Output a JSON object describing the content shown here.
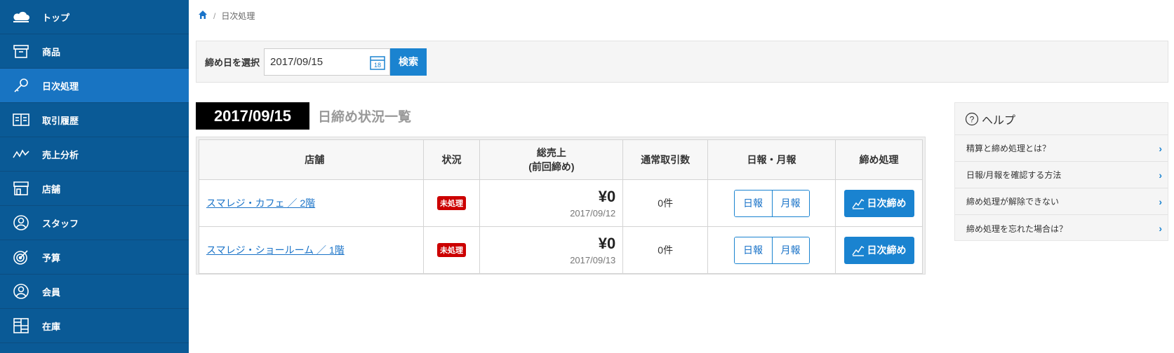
{
  "sidebar": {
    "items": [
      {
        "label": "トップ",
        "icon": "cloud-icon"
      },
      {
        "label": "商品",
        "icon": "box-icon"
      },
      {
        "label": "日次処理",
        "icon": "key-icon",
        "active": true
      },
      {
        "label": "取引履歴",
        "icon": "book-icon"
      },
      {
        "label": "売上分析",
        "icon": "chart-line-icon"
      },
      {
        "label": "店舗",
        "icon": "store-icon"
      },
      {
        "label": "スタッフ",
        "icon": "person-icon"
      },
      {
        "label": "予算",
        "icon": "target-icon"
      },
      {
        "label": "会員",
        "icon": "member-icon"
      },
      {
        "label": "在庫",
        "icon": "grid-icon"
      }
    ]
  },
  "breadcrumb": {
    "separator": "/",
    "current": "日次処理"
  },
  "search": {
    "label": "締め日を選択",
    "date_value": "2017/09/15",
    "calendar_day": "18",
    "button": "検索"
  },
  "list": {
    "date_badge": "2017/09/15",
    "title": "日締め状況一覧"
  },
  "table": {
    "headers": {
      "store": "店舗",
      "status": "状況",
      "sales_line1": "総売上",
      "sales_line2": "(前回締め)",
      "count": "通常取引数",
      "report": "日報・月報",
      "close": "締め処理"
    },
    "rows": [
      {
        "store": "スマレジ・カフェ ／ 2階",
        "status": "未処理",
        "amount": "¥0",
        "date": "2017/09/12",
        "count": "0件",
        "daily": "日報",
        "monthly": "月報",
        "close": "日次締め"
      },
      {
        "store": "スマレジ・ショールーム ／ 1階",
        "status": "未処理",
        "amount": "¥0",
        "date": "2017/09/13",
        "count": "0件",
        "daily": "日報",
        "monthly": "月報",
        "close": "日次締め"
      }
    ]
  },
  "help": {
    "title": "ヘルプ",
    "items": [
      "精算と締め処理とは？",
      "日報/月報を確認する方法",
      "締め処理が解除できない",
      "締め処理を忘れた場合は？"
    ]
  },
  "colors": {
    "sidebar": "#0a5a96",
    "sidebar_active": "#1874c2",
    "accent": "#1a83d0",
    "badge_red": "#cc0000"
  }
}
